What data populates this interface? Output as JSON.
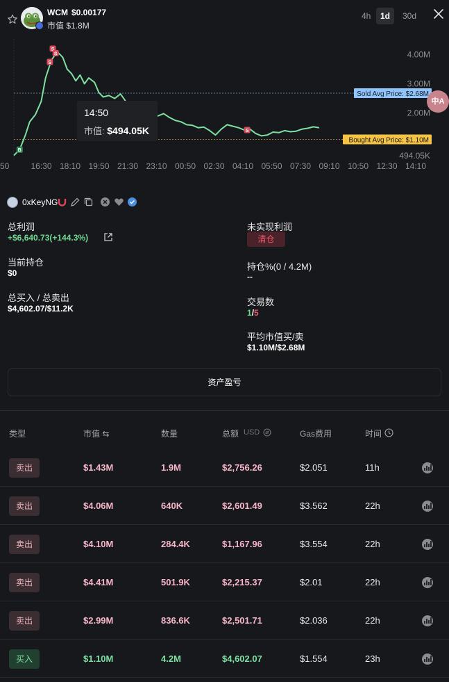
{
  "token": {
    "symbol": "WCM",
    "price": "$0.00177",
    "mcap_label": "市值",
    "mcap_value": "$1.8M",
    "avatar": "frog-token-logo"
  },
  "ranges": [
    {
      "label": "4h",
      "active": false
    },
    {
      "label": "1d",
      "active": true
    },
    {
      "label": "30d",
      "active": false
    }
  ],
  "icons": {
    "star": "star-outline-icon",
    "close": "close-icon",
    "chart_action": "chart-icon"
  },
  "chart_data": {
    "type": "line",
    "x_ticks": [
      "50",
      "16:30",
      "18:10",
      "19:50",
      "21:30",
      "23:10",
      "00:50",
      "02:30",
      "04:10",
      "05:50",
      "07:30",
      "09:10",
      "10:50",
      "12:30",
      "14:10"
    ],
    "y_ticks": [
      "4.00M",
      "3.00M",
      "2.00M",
      "494.05K"
    ],
    "y_range": [
      0.494,
      4.2
    ],
    "series": [
      {
        "color": "#7de0a1",
        "points": [
          [
            0,
            0.55
          ],
          [
            0.2,
            0.75
          ],
          [
            0.4,
            1.25
          ],
          [
            0.55,
            1.7
          ],
          [
            0.75,
            1.95
          ],
          [
            0.95,
            2.4
          ],
          [
            1.1,
            3.2
          ],
          [
            1.3,
            3.8
          ],
          [
            1.5,
            4.1
          ],
          [
            1.7,
            3.9
          ],
          [
            1.85,
            3.5
          ],
          [
            2.0,
            3.35
          ],
          [
            2.15,
            3.1
          ],
          [
            2.3,
            3.3
          ],
          [
            2.45,
            3.0
          ],
          [
            2.6,
            3.2
          ],
          [
            2.8,
            3.05
          ],
          [
            2.95,
            2.7
          ],
          [
            3.1,
            2.55
          ],
          [
            3.3,
            2.6
          ],
          [
            3.5,
            2.5
          ],
          [
            3.7,
            2.65
          ],
          [
            3.85,
            2.45
          ],
          [
            4.0,
            2.2
          ],
          [
            4.2,
            2.1
          ],
          [
            4.4,
            2.0
          ],
          [
            4.6,
            2.05
          ],
          [
            4.8,
            1.95
          ],
          [
            5.0,
            1.9
          ],
          [
            5.2,
            1.98
          ],
          [
            5.4,
            1.85
          ],
          [
            5.6,
            1.75
          ],
          [
            5.8,
            1.7
          ],
          [
            6.0,
            1.6
          ],
          [
            6.2,
            1.58
          ],
          [
            6.4,
            1.5
          ],
          [
            6.6,
            1.52
          ],
          [
            6.8,
            1.4
          ],
          [
            7.0,
            1.25
          ],
          [
            7.2,
            1.45
          ],
          [
            7.4,
            1.6
          ],
          [
            7.6,
            1.55
          ],
          [
            7.8,
            1.5
          ],
          [
            8.0,
            1.42
          ],
          [
            8.2,
            1.45
          ],
          [
            8.4,
            1.3
          ],
          [
            8.6,
            1.22
          ],
          [
            8.8,
            1.25
          ],
          [
            9.0,
            1.35
          ],
          [
            9.2,
            1.33
          ],
          [
            9.4,
            1.4
          ],
          [
            9.6,
            1.36
          ],
          [
            9.8,
            1.38
          ],
          [
            10.0,
            1.45
          ],
          [
            10.2,
            1.48
          ],
          [
            10.4,
            1.53
          ],
          [
            10.6,
            1.5
          ]
        ]
      }
    ],
    "reference_lines": [
      {
        "label": "Sold Avg Price: $2.68M",
        "value": 2.68,
        "color": "#8ec5ff"
      },
      {
        "label": "Bought Avg Price: $1.10M",
        "value": 1.1,
        "color": "#f6c445"
      }
    ],
    "markers": [
      {
        "text": "B",
        "x": 0.2,
        "y": 0.75,
        "kind": "buy"
      },
      {
        "text": "S",
        "x": 1.35,
        "y": 4.2,
        "kind": "sell"
      },
      {
        "text": "S",
        "x": 1.45,
        "y": 4.05,
        "kind": "sell"
      },
      {
        "text": "S",
        "x": 1.25,
        "y": 3.75,
        "kind": "sell"
      },
      {
        "text": "S",
        "x": 8.1,
        "y": 1.42,
        "kind": "sell"
      }
    ],
    "tooltip": {
      "time": "14:50",
      "label": "市值:",
      "value": "$494.05K"
    }
  },
  "wallet": {
    "name": "0xKeyNG",
    "icons": [
      "magnet-icon",
      "edit-icon",
      "copy-icon",
      "x-icon",
      "heart-icon",
      "verified-icon"
    ]
  },
  "stats": {
    "total_profit_label": "总利润",
    "total_profit_value": "+$6,640.73(+144.3%)",
    "unrealized_label": "未实现利润",
    "clear_label": "清仓",
    "holding_label": "当前持仓",
    "holding_value": "$0",
    "holding_pct_label": "持仓%(0 / 4.2M)",
    "holding_pct_value": "--",
    "buy_sell_label": "总买入 / 总卖出",
    "buy_sell_value": "$4,602.07/$11.2K",
    "trades_label": "交易数",
    "trades_buy": "1",
    "trades_sep": "/",
    "trades_sell": "5",
    "avg_label": "平均市值买/卖",
    "avg_value": "$1.10M/$2.68M"
  },
  "pnl_button": "资产盈亏",
  "table": {
    "headers": {
      "type": "类型",
      "mcap": "市值 ⇆",
      "qty": "数量",
      "total": "总额",
      "unit": "USD",
      "gas": "Gas费用",
      "time": "时间"
    },
    "rows": [
      {
        "type": "卖出",
        "kind": "sell",
        "mcap": "$1.43M",
        "qty": "1.9M",
        "total": "$2,756.26",
        "gas": "$2.051",
        "time": "11h"
      },
      {
        "type": "卖出",
        "kind": "sell",
        "mcap": "$4.06M",
        "qty": "640K",
        "total": "$2,601.49",
        "gas": "$3.562",
        "time": "22h"
      },
      {
        "type": "卖出",
        "kind": "sell",
        "mcap": "$4.10M",
        "qty": "284.4K",
        "total": "$1,167.96",
        "gas": "$3.554",
        "time": "22h"
      },
      {
        "type": "卖出",
        "kind": "sell",
        "mcap": "$4.41M",
        "qty": "501.9K",
        "total": "$2,215.37",
        "gas": "$2.01",
        "time": "22h"
      },
      {
        "type": "卖出",
        "kind": "sell",
        "mcap": "$2.99M",
        "qty": "836.6K",
        "total": "$2,501.71",
        "gas": "$2.036",
        "time": "22h"
      },
      {
        "type": "买入",
        "kind": "buy",
        "mcap": "$1.10M",
        "qty": "4.2M",
        "total": "$4,602.07",
        "gas": "$1.554",
        "time": "23h"
      }
    ]
  },
  "float_button": "中A"
}
